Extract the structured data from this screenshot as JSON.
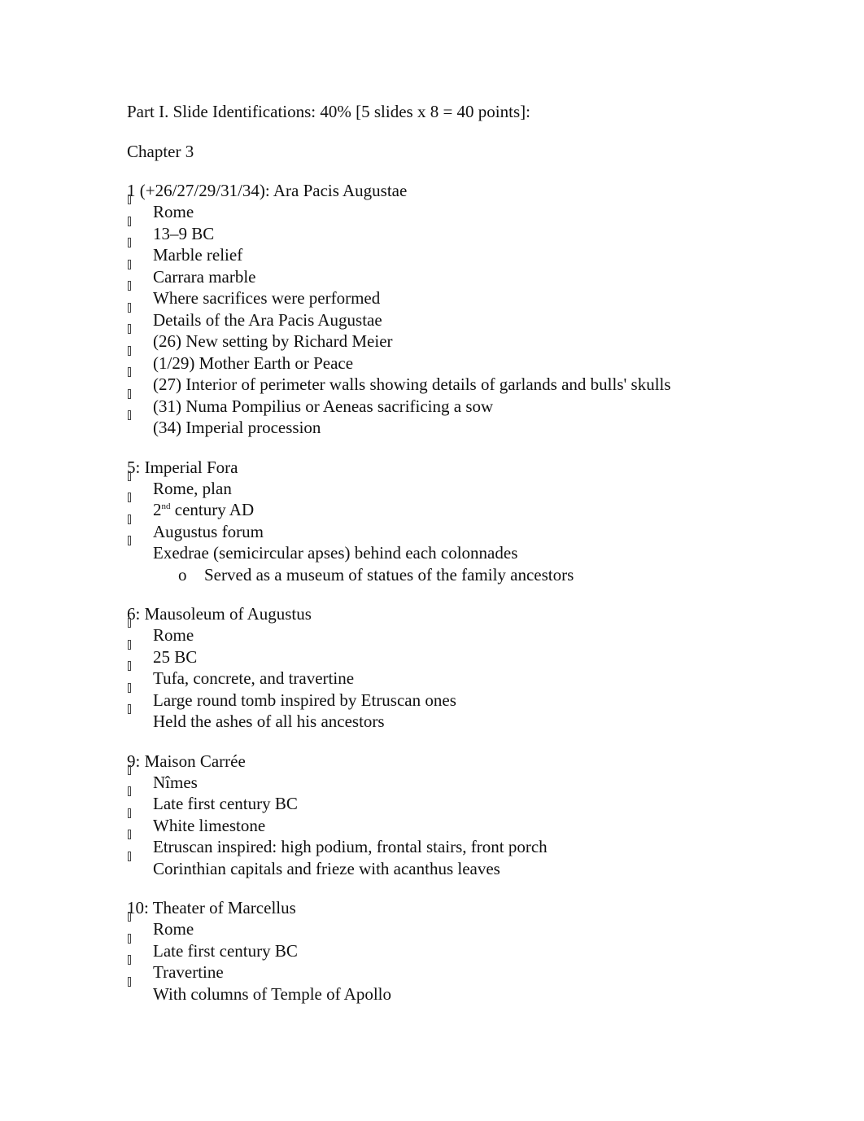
{
  "document": {
    "part_label": "Part I.",
    "part_title": "Slide Identifications: 40% [5 slides x 8 = 40 points]:",
    "chapter": "Chapter 3",
    "bullet_icon": "missing-glyph-bullet",
    "sections": [
      {
        "heading": "1 (+26/27/29/31/34): Ara Pacis Augustae",
        "items": [
          "Rome",
          "13–9 BC",
          "Marble relief",
          "Carrara marble",
          "Where sacrifices were performed",
          "Details of the Ara Pacis Augustae",
          "(26) New setting by Richard Meier",
          "(1/29) Mother Earth or Peace",
          "(27) Interior of perimeter walls showing details of garlands and bulls' skulls",
          "(31) Numa Pompilius or Aeneas sacrificing a sow",
          "(34) Imperial procession"
        ]
      },
      {
        "heading": "5: Imperial Fora",
        "items": [
          "Rome, plan",
          {
            "prefix": "2",
            "sup": "nd",
            "rest": " century AD"
          },
          "Augustus forum",
          "Exedrae (semicircular apses) behind each colonnades"
        ],
        "subitem_marker": "o",
        "subitems": [
          "Served as a museum of statues of the family ancestors"
        ]
      },
      {
        "heading": "6: Mausoleum of Augustus",
        "items": [
          "Rome",
          "25 BC",
          "Tufa, concrete, and travertine",
          "Large round tomb inspired by Etruscan ones",
          "Held the ashes of all his ancestors"
        ]
      },
      {
        "heading": "9: Maison Carrée",
        "items": [
          "Nîmes",
          "Late first century BC",
          "White limestone",
          "Etruscan inspired: high podium, frontal stairs, front porch",
          "Corinthian capitals and frieze with acanthus leaves"
        ]
      },
      {
        "heading": "10: Theater of Marcellus",
        "items": [
          "Rome",
          "Late first century BC",
          "Travertine",
          "With columns of Temple of Apollo"
        ]
      }
    ]
  }
}
